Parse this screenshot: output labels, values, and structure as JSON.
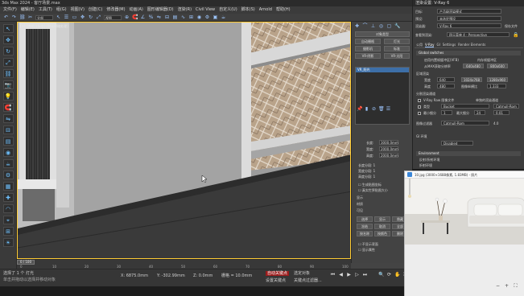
{
  "max": {
    "title": "3ds Max 2024 - 客厅场景.max",
    "menus": [
      "文件(F)",
      "编辑(E)",
      "工具(T)",
      "组(G)",
      "视图(V)",
      "创建(C)",
      "修改器(M)",
      "动画(A)",
      "图形编辑器(D)",
      "渲染(R)",
      "Civil View",
      "自定义(U)",
      "脚本(S)",
      "Arnold",
      "帮助(H)"
    ],
    "toolbar_selection_filter": "全部",
    "toolbar_view": "视图",
    "left_icons": [
      "select-icon",
      "move-icon",
      "rotate-icon",
      "scale-icon",
      "link-icon",
      "camera-icon",
      "light-icon",
      "snap-icon",
      "mirror-icon",
      "align-icon",
      "layer-icon",
      "material-icon",
      "render-icon",
      "settings-icon",
      "grid-icon",
      "helper-icon",
      "shape-icon",
      "space-icon",
      "system-icon",
      "sun-icon"
    ],
    "viewport_label": "[+] [透视] [标准] [默认明暗处理]",
    "cmd": {
      "object_type_btns": [
        "对象类型",
        "自动栅格",
        "灯光",
        "摄影机",
        "标准",
        "VR-阴影",
        "VR-太阳"
      ],
      "list_selected": "VR_阳光",
      "params": [
        {
          "label": "长度:",
          "value": "3000.0mm"
        },
        {
          "label": "宽度:",
          "value": "2000.0mm"
        },
        {
          "label": "高度:",
          "value": "2000.0mm"
        }
      ],
      "segments": [
        "长度分段: 1",
        "宽度分段: 1",
        "高度分段: 1"
      ],
      "checks": [
        "生成贴图坐标",
        "真实世界贴图大小"
      ],
      "section_labels": [
        "显示",
        "材质",
        "可见"
      ],
      "grid_btns": [
        "选择",
        "显示",
        "隐藏",
        "冻结",
        "取消",
        "全部",
        "按名称",
        "按颜色",
        "删除"
      ],
      "bottom_checks": [
        "不显示背面",
        "显示属性"
      ]
    },
    "timeline": {
      "frame": "0 / 100",
      "ticks": [
        "0",
        "10",
        "20",
        "30",
        "40",
        "50",
        "60",
        "70",
        "80",
        "90",
        "100"
      ]
    },
    "status": {
      "selection": "选择了 1 个 灯光",
      "prompt": "单击并拖动以选择并移动对象",
      "x": "X: 6875.0mm",
      "y": "Y: -302.99mm",
      "z": "Z: 0.0mm",
      "grid": "栅格 = 10.0mm",
      "autokey": "自动关键点",
      "selected": "选定对象",
      "setkey": "设置关键点",
      "filters": "关键点过滤器..."
    }
  },
  "render": {
    "title": "渲染设置: V-Ray 6",
    "target_label": "目标:",
    "target": "产品级渲染模式",
    "preset_label": "预设:",
    "preset": "未选定预设",
    "renderer_label": "渲染器:",
    "renderer": "V-Ray 6",
    "save_label": "保存文件",
    "view_label": "查看到渲染:",
    "view": "四元菜单 4 - Perspective",
    "tabs": [
      "公用",
      "V-Ray",
      "GI",
      "Settings",
      "Render Elements"
    ],
    "active_tab": "V-Ray",
    "rollouts": [
      "Global switches",
      "Frame buffer",
      "Environment"
    ],
    "frame_buffer": {
      "enable": "启用内置帧缓冲区(VFB)",
      "memory": "内存帧缓冲区",
      "output": "从MAX获取分辨率",
      "region": "区域渲染",
      "width_label": "宽度",
      "width": "640",
      "height_label": "高度",
      "height": "480",
      "aspect_label": "图像纵横比",
      "aspect": "1.333",
      "split": "分割渲染通道",
      "vray_raw": "V-Ray Raw 图像文件",
      "separate": "单独的渲染通道",
      "btns": [
        "640x480",
        "800x600",
        "1024x768",
        "1280x960"
      ]
    },
    "image_sampler": {
      "type_label": "类型",
      "type": "Bucket",
      "min_label": "最小细分",
      "min": "1",
      "max_label": "最大细分",
      "max": "24",
      "threshold": "0.01",
      "filter_label": "图像过滤器",
      "filter": "Catmull-Rom",
      "size": "4.0"
    },
    "environment": {
      "gi_label": "GI 环境",
      "gi": "Disabled",
      "color_label": "颜色",
      "multiplier": "1.0",
      "overrides": [
        "反射/折射环境",
        "折射环境",
        "二次射线环境"
      ]
    }
  },
  "viewer": {
    "title": "10.jpg (3000×1688像素, 1.83MB) - 照片",
    "controls": [
      "缩小",
      "放大",
      "上一张",
      "下一张",
      "全屏"
    ]
  }
}
